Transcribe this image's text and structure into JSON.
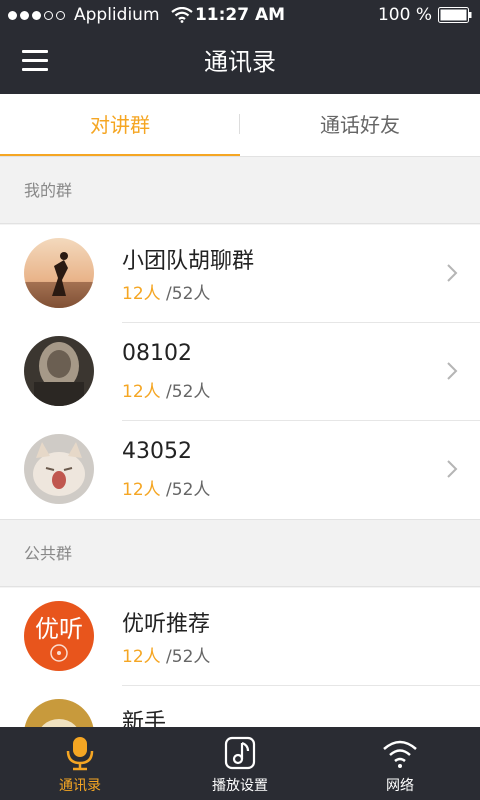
{
  "status_bar": {
    "carrier": "Applidium",
    "time": "11:27 AM",
    "battery": "100 %"
  },
  "nav": {
    "title": "通讯录"
  },
  "tabs": [
    {
      "label": "对讲群"
    },
    {
      "label": "通话好友"
    }
  ],
  "sections": {
    "mine": {
      "title": "我的群",
      "groups": [
        {
          "name": "小团队胡聊群",
          "online": "12人",
          "total": " /52人"
        },
        {
          "name": "08102",
          "online": "12人",
          "total": " /52人"
        },
        {
          "name": "43052",
          "online": "12人",
          "total": " /52人"
        }
      ]
    },
    "public": {
      "title": "公共群",
      "groups": [
        {
          "name": "优听推荐",
          "online": "12人",
          "total": " /52人",
          "logo_text": "优听"
        },
        {
          "name": "新手"
        }
      ]
    }
  },
  "tabbar": [
    {
      "label": "通讯录",
      "icon": "microphone-icon"
    },
    {
      "label": "播放设置",
      "icon": "music-note-icon"
    },
    {
      "label": "网络",
      "icon": "wifi-icon"
    }
  ],
  "colors": {
    "accent": "#f5a623",
    "bar": "#2a2c33"
  }
}
